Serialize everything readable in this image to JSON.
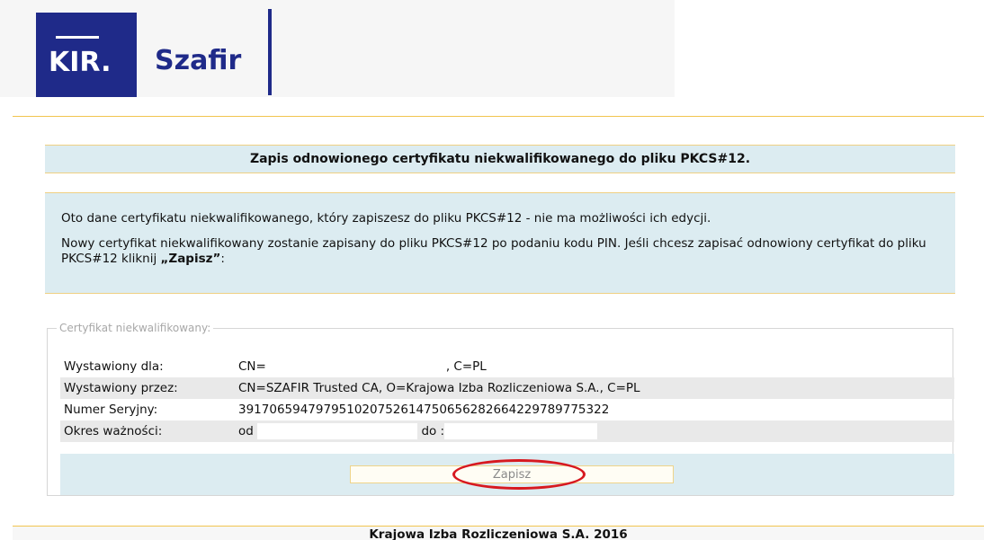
{
  "header": {
    "kir_logo_text": "KIR",
    "brand_text": "Szafir"
  },
  "page": {
    "title": "Zapis odnowionego certyfikatu niekwalifikowanego do pliku PKCS#12."
  },
  "info": {
    "line1": "Oto dane certyfikatu niekwalifikowanego, który zapiszesz do pliku PKCS#12 - nie ma możliwości ich edycji.",
    "line2_prefix": "Nowy certyfikat niekwalifikowany zostanie zapisany do pliku PKCS#12 po podaniu kodu PIN. Jeśli chcesz zapisać odnowiony certyfikat do pliku PKCS#12 kliknij ",
    "line2_bold": "„Zapisz”",
    "line2_suffix": ":"
  },
  "certificate": {
    "legend": "Certyfikat niekwalifikowany:",
    "issued_to_label": "Wystawiony dla:",
    "issued_to_prefix": "CN=",
    "issued_to_suffix": ", C=PL",
    "issued_by_label": "Wystawiony przez:",
    "issued_by_value": "CN=SZAFIR Trusted CA, O=Krajowa Izba Rozliczeniowa S.A., C=PL",
    "serial_label": "Numer Seryjny:",
    "serial_value": "391706594797951020752614750656282664229789775322",
    "validity_label": "Okres ważności:",
    "validity_from": "od",
    "validity_to": "do :"
  },
  "actions": {
    "save_label": "Zapisz"
  },
  "footer": {
    "text": "Krajowa Izba Rozliczeniowa S.A. 2016"
  },
  "colors": {
    "brand_navy": "#1f2a89",
    "panel_blue": "#dcecf1",
    "accent_gold": "#f1c54f",
    "highlight_red": "#d71920"
  }
}
